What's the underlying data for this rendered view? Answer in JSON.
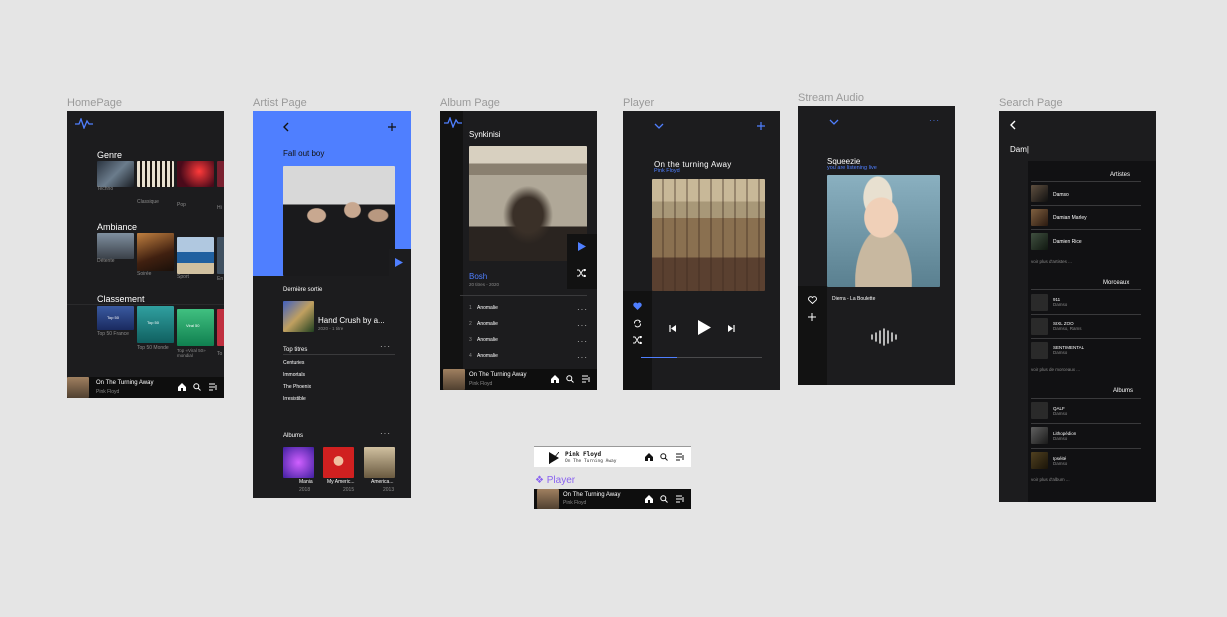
{
  "frames": {
    "home": "HomePage",
    "artist": "Artist Page",
    "album": "Album Page",
    "player": "Player",
    "stream": "Stream Audio",
    "search": "Search Page"
  },
  "home": {
    "genre_title": "Genre",
    "genres": [
      "Techno",
      "Classique",
      "Pop",
      "Hi"
    ],
    "ambiance_title": "Ambiance",
    "ambiances": [
      "Détente",
      "Soirée",
      "Sport",
      "En"
    ],
    "classement_title": "Classement",
    "tops": [
      {
        "cover": "Top 50",
        "label": "Top 50 France"
      },
      {
        "cover": "Top 50",
        "label": "Top 50 Monde"
      },
      {
        "cover": "Viral 50",
        "label": "Top «Viral 50» mondial"
      },
      {
        "cover": "",
        "label": "To"
      }
    ]
  },
  "nowplaying": {
    "title": "On The Turning Away",
    "artist": "Pink Floyd"
  },
  "artist": {
    "name": "Fall out boy",
    "latest_title": "Dernière sortie",
    "latest_album": "Hand Crush by a...",
    "latest_meta": "2020 - 1 titre",
    "top_title": "Top titres",
    "top_tracks": [
      "Centuries",
      "Immortals",
      "The Phoenix",
      "Irresistible"
    ],
    "albums_title": "Albums",
    "albums": [
      {
        "name": "Mania",
        "year": "2018"
      },
      {
        "name": "My Americ...",
        "year": "2015"
      },
      {
        "name": "America...",
        "year": "2013"
      }
    ]
  },
  "album": {
    "title": "Synkinisi",
    "artist": "Bosh",
    "meta": "20 titres - 2020",
    "tracks": [
      {
        "n": "1",
        "name": "Anomalie"
      },
      {
        "n": "2",
        "name": "Anomalie"
      },
      {
        "n": "3",
        "name": "Anomalie"
      },
      {
        "n": "4",
        "name": "Anomalie"
      }
    ]
  },
  "player": {
    "title": "On the turning Away",
    "artist": "Pink Floyd",
    "progress": 0.3
  },
  "stream": {
    "artist": "Squeezie",
    "subtitle": "you are listening live",
    "track": "Dierra - La Boulette"
  },
  "search": {
    "query": "Dam|",
    "artists_title": "Artistes",
    "artists": [
      "Damso",
      "Damian Marley",
      "Damien Rice"
    ],
    "more_artists": "voir plus d'artistes ...",
    "tracks_title": "Morceaux",
    "tracks": [
      {
        "name": "911",
        "sub": "Damso"
      },
      {
        "name": "SIXL ZOO",
        "sub": "Damso, Rams"
      },
      {
        "name": "SENTIMENTAL",
        "sub": "Damso"
      }
    ],
    "more_tracks": "voir plus de morceaux ...",
    "albums_title": "Albums",
    "albums": [
      {
        "name": "QALF",
        "sub": "Damso"
      },
      {
        "name": "Lithopédion",
        "sub": "Damso"
      },
      {
        "name": "Ipséité",
        "sub": "Damso"
      }
    ],
    "more_albums": "voir plus d'album ..."
  },
  "component": {
    "mini_title": "Pink Floyd",
    "mini_sub": "On The Turning Away",
    "label": "❖ Player"
  },
  "colors": {
    "accent": "#4f7fff",
    "frame_bg": "#1c1c1e",
    "canvas": "#e5e5e5"
  }
}
